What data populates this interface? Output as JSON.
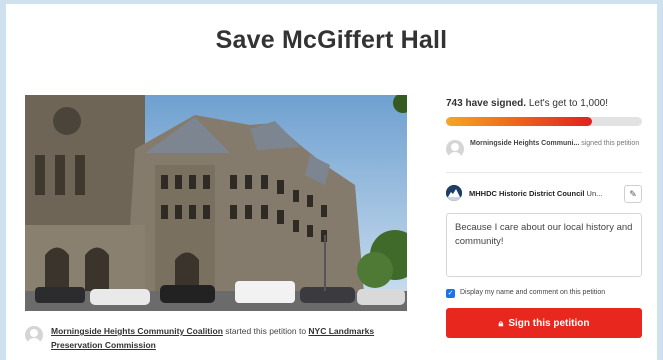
{
  "page": {
    "title": "Save McGiffert Hall"
  },
  "photo": {
    "icon": "building-photo"
  },
  "starter": {
    "org": "Morningside Heights Community Coalition",
    "middle": " started this petition to ",
    "target": "NYC Landmarks Preservation Commission"
  },
  "progress": {
    "signed_bold": "743 have signed.",
    "goal_text": " Let's get to 1,000!",
    "signed_count": 743,
    "goal": 1000
  },
  "recent_signer": {
    "name": "Morningside Heights Communi...",
    "action": " signed this petition"
  },
  "target": {
    "name": "MHHDC Historic District Council",
    "suffix": " Un...",
    "edit_icon": "edit-icon"
  },
  "comment": {
    "value": "Because I care about our local history and community!"
  },
  "display_option": {
    "label": "Display my name and comment on this petition",
    "checked": true
  },
  "sign_button": {
    "label": "Sign this petition",
    "icon": "lock-icon"
  },
  "colors": {
    "button": "#e8281e",
    "progress_start": "#f5a623",
    "progress_end": "#e0211f",
    "checkbox": "#1a73e8"
  }
}
